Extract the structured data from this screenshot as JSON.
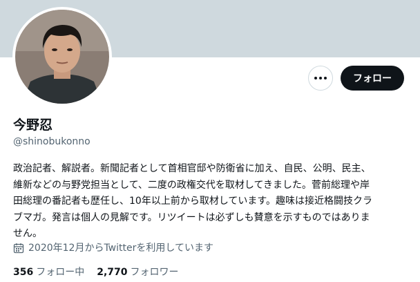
{
  "profile": {
    "display_name": "今野忍",
    "handle": "@shinobukonno",
    "bio_lines": [
      "政治記者、解説者。新聞記者として首相官邸や防衛省に加え、自民、公明、民主、",
      "維新などの与野党担当として、二度の政権交代を取材してきました。菅前総理や岸",
      "田総理の番記者も歴任し、10年以上前から取材しています。趣味は接近格闘技クラ",
      "ブマガ。発言は個人の見解です。リツイートは必ずしも賛意を示すものではありま",
      "せん。"
    ],
    "joined": "2020年12月からTwitterを利用しています"
  },
  "buttons": {
    "follow_label": "フォロー",
    "more_icon": "more-horizontal-icon"
  },
  "stats": {
    "following_count": "356",
    "following_label": "フォロー中",
    "followers_count": "2,770",
    "followers_label": "フォロワー"
  },
  "colors": {
    "banner": "#cfd9de",
    "primary_text": "#0f1419",
    "secondary_text": "#536471",
    "follow_button_bg": "#0f1419"
  }
}
